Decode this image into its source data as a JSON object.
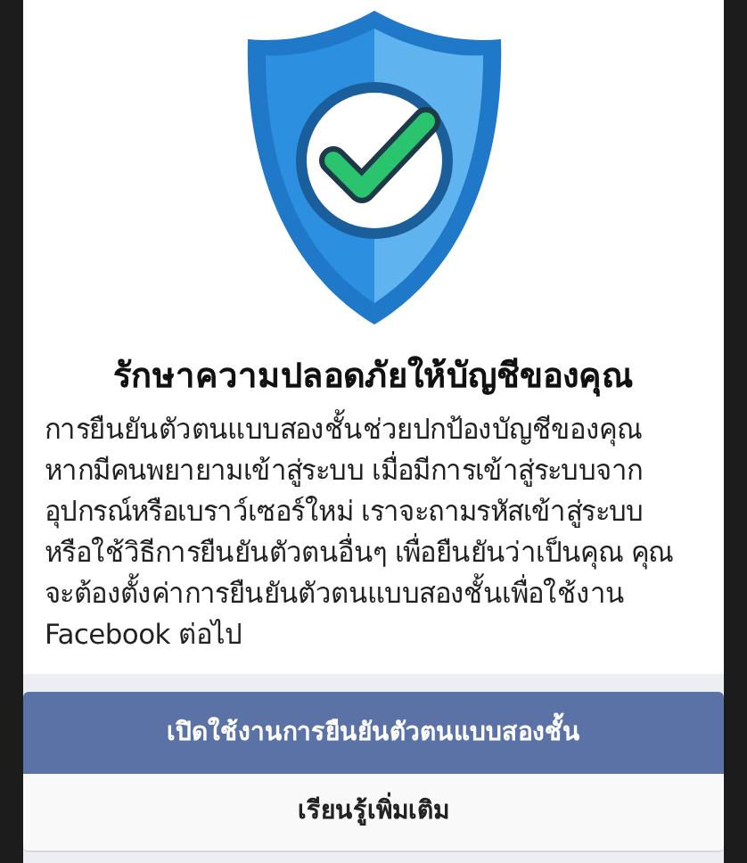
{
  "title": "รักษาความปลอดภัยให้บัญชีของคุณ",
  "body_lines": [
    "การยืนยันตัวตนแบบสองชั้นช่วยปกป้องบัญชีของคุณ",
    "หากมีคนพยายามเข้าสู่ระบบ เมื่อมีการเข้าสู่ระบบจาก",
    "อุปกรณ์หรือเบราว์เซอร์ใหม่ เราจะถามรหัสเข้าสู่ระบบ",
    "หรือใช้วิธีการยืนยันตัวตนอื่นๆ เพื่อยืนยันว่าเป็นคุณ คุณ",
    "จะต้องตั้งค่าการยืนยันตัวตนแบบสองชั้นเพื่อใช้งาน",
    "Facebook ต่อไป"
  ],
  "buttons": [
    {
      "label": "เปิดใช้งานการยืนยันตัวตนแบบสองชั้น",
      "kind": "primary"
    },
    {
      "label": "เรียนรู้เพิ่มเติม",
      "kind": "secondary"
    }
  ]
}
